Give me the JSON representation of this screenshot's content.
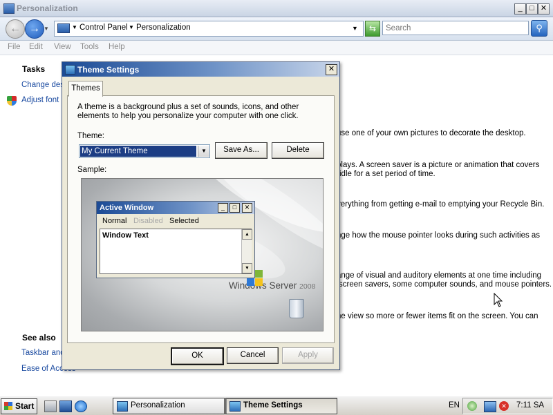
{
  "main_window": {
    "title": "Personalization",
    "controls": {
      "minimize": "_",
      "maximize": "□",
      "close": "✕"
    }
  },
  "address_bar": {
    "breadcrumbs": [
      "Control Panel",
      "Personalization"
    ],
    "search_placeholder": "Search"
  },
  "menu": [
    "File",
    "Edit",
    "View",
    "Tools",
    "Help"
  ],
  "left_pane": {
    "tasks_heading": "Tasks",
    "tasks": [
      "Change des",
      "Adjust font"
    ],
    "see_also_heading": "See also",
    "see_also": [
      "Taskbar and",
      "Ease of Access"
    ]
  },
  "right_pane": {
    "lines": [
      "use one of your own pictures to decorate the desktop.",
      "plays. A screen saver is a picture or animation that covers",
      "idle for a set period of time.",
      "verything from getting e-mail to emptying your Recycle Bin.",
      "nge how the mouse pointer looks during such activities as",
      "ange of visual and auditory elements at one time including",
      "screen savers, some computer sounds, and mouse pointers.",
      "he view so more or fewer items fit on the screen. You can"
    ]
  },
  "dialog": {
    "title": "Theme Settings",
    "close": "✕",
    "tab": "Themes",
    "description_line1": "A theme is a background plus a set of sounds, icons, and other",
    "description_line2": "elements to help you personalize your computer with one click.",
    "theme_label": "Theme:",
    "theme_value": "My Current Theme",
    "save_as": "Save As...",
    "delete": "Delete",
    "sample_label": "Sample:",
    "sample": {
      "window_title": "Active Window",
      "menu": [
        "Normal",
        "Disabled",
        "Selected"
      ],
      "window_text": "Window Text",
      "logo_text": "Windows Server",
      "logo_year": "2008"
    },
    "ok": "OK",
    "cancel": "Cancel",
    "apply": "Apply"
  },
  "taskbar": {
    "start": "Start",
    "buttons": [
      "Personalization",
      "Theme Settings"
    ],
    "language": "EN",
    "clock": "7:11 SA"
  },
  "colors": {
    "title_gradient_start": "#1b4a95",
    "selection": "#1c3d84",
    "link": "#1a4aa0",
    "dialog_face": "#ece9d8"
  }
}
